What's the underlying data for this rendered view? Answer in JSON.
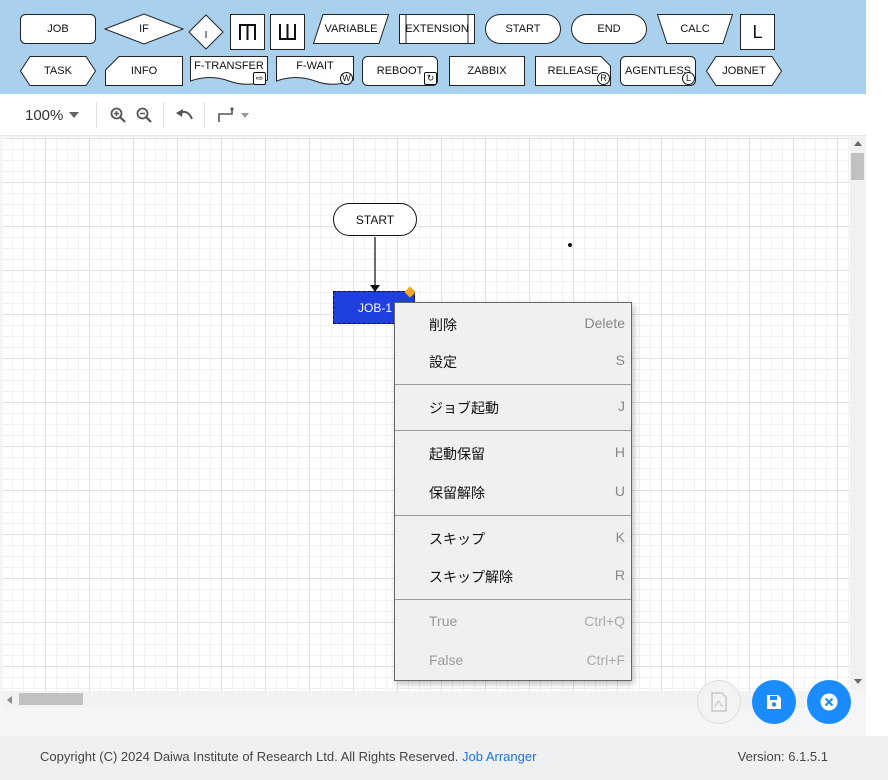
{
  "palette": {
    "row1": [
      "JOB",
      "IF",
      "I",
      "",
      "",
      "VARIABLE",
      "EXTENSION",
      "START",
      "END",
      "CALC",
      "L"
    ],
    "row2": [
      "TASK",
      "INFO",
      "F-TRANSFER",
      "F-WAIT",
      "REBOOT",
      "ZABBIX",
      "RELEASE",
      "AGENTLESS",
      "JOBNET"
    ],
    "badges": {
      "fwait": "W",
      "release": "R",
      "agentless": "L"
    }
  },
  "toolbar": {
    "zoom": "100%"
  },
  "canvas": {
    "start_node": "START",
    "job_node": "JOB-1"
  },
  "context_menu": {
    "items": [
      {
        "label": "削除",
        "key": "Delete"
      },
      {
        "label": "設定",
        "key": "S"
      },
      {
        "label": "ジョブ起動",
        "key": "J"
      },
      {
        "label": "起動保留",
        "key": "H"
      },
      {
        "label": "保留解除",
        "key": "U"
      },
      {
        "label": "スキップ",
        "key": "K"
      },
      {
        "label": "スキップ解除",
        "key": "R"
      },
      {
        "label": "True",
        "key": "Ctrl+Q"
      },
      {
        "label": "False",
        "key": "Ctrl+F"
      }
    ]
  },
  "footer": {
    "copyright": "Copyright (C) 2024 Daiwa Institute of Research Ltd. All Rights Reserved.",
    "link": "Job Arranger",
    "version": "Version: 6.1.5.1"
  },
  "colors": {
    "palette_bg": "#a9d0ec",
    "selected_job": "#1f3fe0",
    "save_button": "#1a8cff",
    "close_button": "#1a8cff",
    "link": "#1a73e8"
  }
}
